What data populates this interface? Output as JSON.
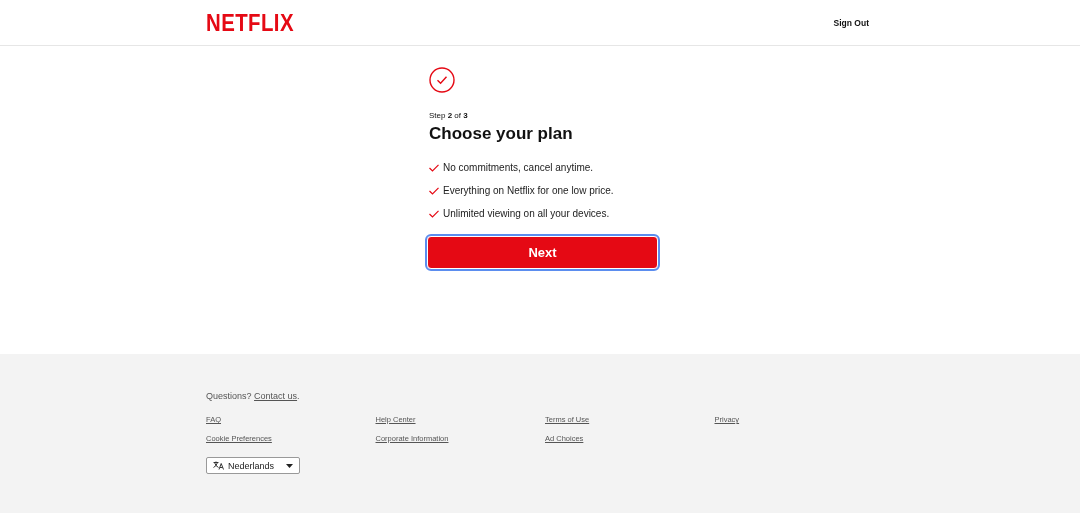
{
  "header": {
    "logo": "NETFLIX",
    "sign_out": "Sign Out"
  },
  "plan": {
    "step": "Step **2** of **3**",
    "title": "Choose your plan",
    "benefits": [
      "No commitments, cancel anytime.",
      "Everything on Netflix for one low price.",
      "Unlimited viewing on all your devices."
    ],
    "next_button": {
      "label": "Next",
      "focused": true
    }
  },
  "footer": {
    "question": "Questions? ",
    "contact_link": "Contact us",
    "question_end": ".",
    "links": [
      "FAQ",
      "Help Center",
      "Terms of Use",
      "Privacy",
      "Cookie Preferences",
      "Corporate Information",
      "Ad Choices"
    ],
    "language": "Nederlands"
  }
}
